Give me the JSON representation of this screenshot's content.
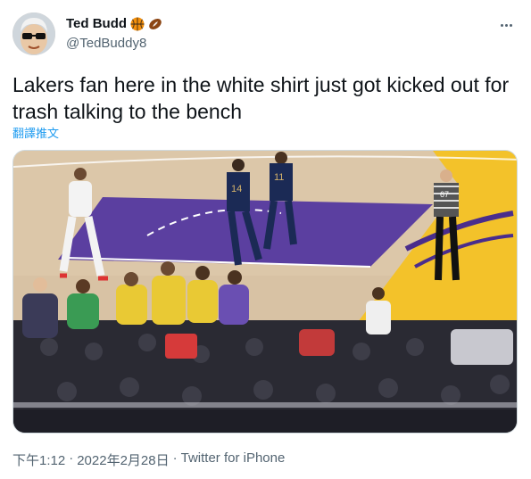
{
  "author": {
    "display_name": "Ted Budd",
    "handle": "@TedBuddy8",
    "badge_icons": [
      "basketball-icon",
      "football-icon"
    ]
  },
  "tweet": {
    "text": "Lakers fan here in the white shirt just got kicked out for trash talking to the bench",
    "translate_label": "翻譯推文",
    "media_alt": "Video frame of an NBA game at the Lakers arena: players on the court and fans courtside"
  },
  "meta": {
    "time": "下午1:12",
    "separator": "·",
    "date": "2022年2月28日",
    "source": "Twitter for iPhone"
  },
  "colors": {
    "link": "#1d9bf0",
    "secondary_text": "#536471",
    "primary_text": "#0f1419",
    "lakers_purple": "#4a2d8c",
    "lakers_gold": "#f3c22a"
  }
}
